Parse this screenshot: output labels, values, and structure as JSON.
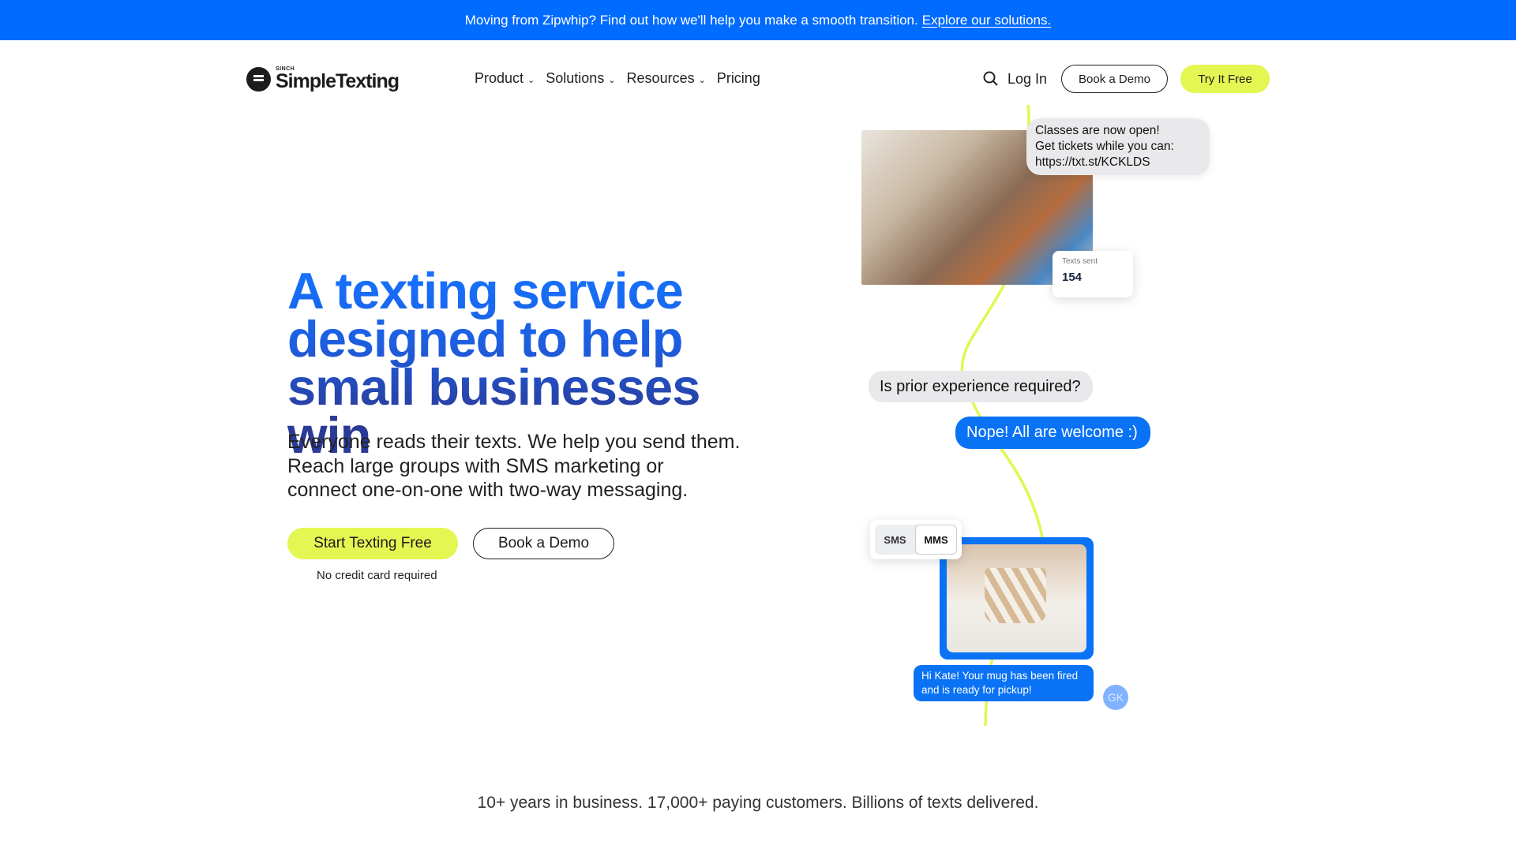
{
  "banner": {
    "text": "Moving from Zipwhip? Find out how we'll help you make a smooth transition.",
    "link": "Explore our solutions."
  },
  "logo": {
    "small": "SINCH",
    "big": "SimpleTexting"
  },
  "nav": {
    "items": [
      {
        "label": "Product",
        "dropdown": true
      },
      {
        "label": "Solutions",
        "dropdown": true
      },
      {
        "label": "Resources",
        "dropdown": true
      },
      {
        "label": "Pricing",
        "dropdown": false
      }
    ],
    "login": "Log In",
    "book_demo": "Book a Demo",
    "try_free": "Try It Free"
  },
  "hero": {
    "headline": [
      "A texting service",
      "designed to help",
      "small businesses win"
    ],
    "subtext": [
      "Everyone reads their texts. We help you send them.",
      "Reach large groups with SMS marketing or",
      "connect one-on-one with two-way messaging."
    ],
    "cta_primary": "Start Texting Free",
    "cta_secondary": "Book a Demo",
    "note": "No credit card required"
  },
  "illustration": {
    "message1": [
      "Classes are now open!",
      "Get tickets while you can:",
      "https://txt.st/KCKLDS"
    ],
    "stat_label": "Texts sent",
    "stat_value": "154",
    "question": "Is prior experience required?",
    "reply": "Nope! All are welcome :)",
    "toggle": [
      "SMS",
      "MMS"
    ],
    "toggle_selected": "MMS",
    "message2": [
      "Hi Kate! Your mug has been fired",
      "and is ready for pickup!"
    ],
    "avatar": "GK"
  },
  "stats": "10+ years in business. 17,000+ paying customers. Billions of texts delivered.",
  "colors": {
    "brand_blue": "#006bff",
    "accent_yellow": "#e3f651",
    "headline_navy": "#2b3a96"
  }
}
